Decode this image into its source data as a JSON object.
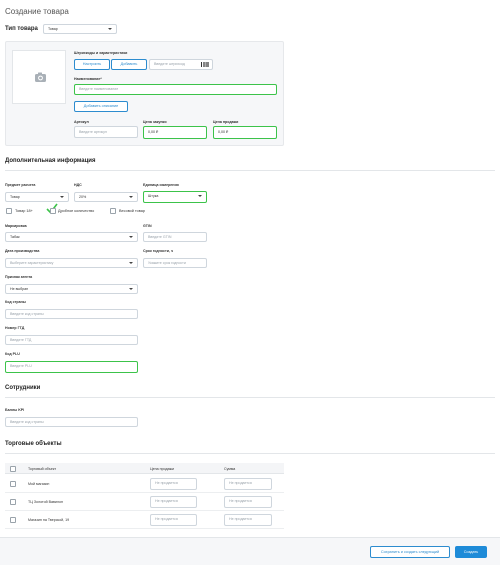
{
  "page": {
    "title": "Создание товара"
  },
  "product_type": {
    "label": "Тип товара",
    "value": "Товар"
  },
  "card": {
    "barcodes_label": "Штрихкоды и характеристики",
    "configure_btn": "Настроить",
    "add_btn": "Добавить",
    "barcode_placeholder": "Введите штрихкод",
    "name_label": "Наименование*",
    "name_placeholder": "Введите наименование",
    "add_description_btn": "Добавить описание",
    "article_label": "Артикул",
    "article_placeholder": "Введите артикул",
    "purchase_label": "Цена закупки",
    "purchase_value": "0,00 ₽",
    "sale_label": "Цена продажи",
    "sale_value": "0,00 ₽"
  },
  "extra": {
    "title": "Дополнительная информация",
    "calc_subject_label": "Предмет расчета",
    "calc_subject_value": "Товар",
    "vat_label": "НДС",
    "vat_value": "20%",
    "unit_label": "Единица измерения",
    "unit_value": "Штука",
    "cb_18": "Товар 18+",
    "cb_fractional": "Дробное количество",
    "cb_weighed": "Весовой товар",
    "marking_label": "Маркировка",
    "marking_value": "Табак",
    "gtin_label": "GTIN",
    "gtin_placeholder": "Введите GTIN",
    "prod_date_label": "Дата производства",
    "prod_date_placeholder": "Выберите характеристику",
    "shelf_life_label": "Срок годности, ч",
    "shelf_life_placeholder": "Укажите срок годности",
    "agent_label": "Признак агента",
    "agent_value": "Не выбран",
    "country_label": "Код страны",
    "country_placeholder": "Введите код страны",
    "gtd_label": "Номер ГТД",
    "gtd_placeholder": "Введите ГТД",
    "plu_label": "Код PLU",
    "plu_placeholder": "Введите PLU"
  },
  "staff": {
    "title": "Сотрудники",
    "kpi_label": "Баллы KPI",
    "kpi_placeholder": "Введите код страны"
  },
  "stores": {
    "title": "Торговые объекты",
    "headers": [
      "Торговый объект",
      "Цена продажи",
      "Сумма"
    ],
    "rows": [
      {
        "name": "Мой магазин",
        "price": "Не продается",
        "sum": "Не продается"
      },
      {
        "name": "ТЦ Золотой Вавилон",
        "price": "Не продается",
        "sum": "Не продается"
      },
      {
        "name": "Магазин на Тверской, 19",
        "price": "Не продается",
        "sum": "Не продается"
      }
    ]
  },
  "footer": {
    "save_next_btn": "Сохранить и создать следующий",
    "create_btn": "Создать"
  },
  "colors": {
    "accent": "#1e8bd8",
    "highlight": "#3cc34a"
  }
}
